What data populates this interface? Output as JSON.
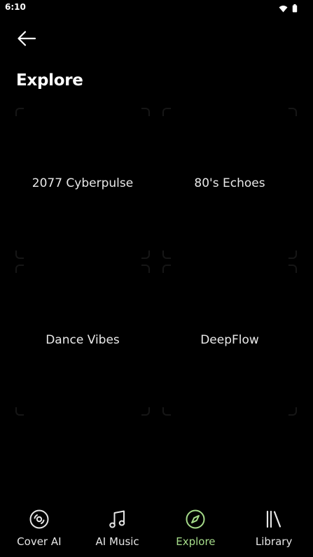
{
  "status_bar": {
    "time": "6:10",
    "icons": [
      "wifi-icon",
      "battery-icon"
    ]
  },
  "header": {
    "back_icon": "arrow-left-icon",
    "title": "Explore"
  },
  "cards": [
    {
      "label": "2077 Cyberpulse"
    },
    {
      "label": "80's Echoes"
    },
    {
      "label": "Dance Vibes"
    },
    {
      "label": "DeepFlow"
    }
  ],
  "bottom_nav": {
    "items": [
      {
        "label": "Cover AI",
        "icon": "disc-icon"
      },
      {
        "label": "AI Music",
        "icon": "music-note-icon"
      },
      {
        "label": "Explore",
        "icon": "compass-icon",
        "active": true
      },
      {
        "label": "Library",
        "icon": "library-icon"
      }
    ]
  },
  "colors": {
    "background": "#000000",
    "text": "#ffffff",
    "accent": "#a6dc8a"
  }
}
